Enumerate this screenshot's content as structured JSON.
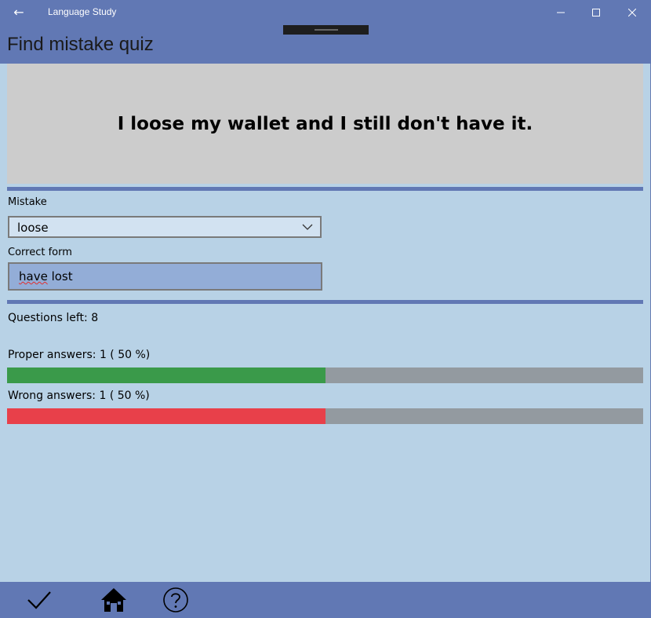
{
  "window": {
    "app_title": "Language Study",
    "back_glyph": "←",
    "controls": [
      "minimize-icon",
      "maximize-icon",
      "close-icon"
    ]
  },
  "header": {
    "title": "Find mistake quiz"
  },
  "quiz": {
    "sentence": "I loose my wallet and I still don't have it.",
    "mistake_label": "Mistake",
    "mistake_value": "loose",
    "correct_label": "Correct form",
    "correct_value_misspelled": "have",
    "correct_value_rest": " lost"
  },
  "stats": {
    "questions_left": "Questions left:  8",
    "proper": "Proper answers:  1  ( 50  %)",
    "proper_fraction": 0.5,
    "wrong": "Wrong answers:  1  ( 50  %)",
    "wrong_fraction": 0.5
  },
  "colors": {
    "accent": "#6178b4",
    "background": "#b8d2e6",
    "proper_fill": "#3a9a4a",
    "wrong_fill": "#e8404a",
    "bar_track": "#939aa0"
  },
  "bottom_bar": [
    "checkmark-icon",
    "home-icon",
    "help-icon"
  ]
}
